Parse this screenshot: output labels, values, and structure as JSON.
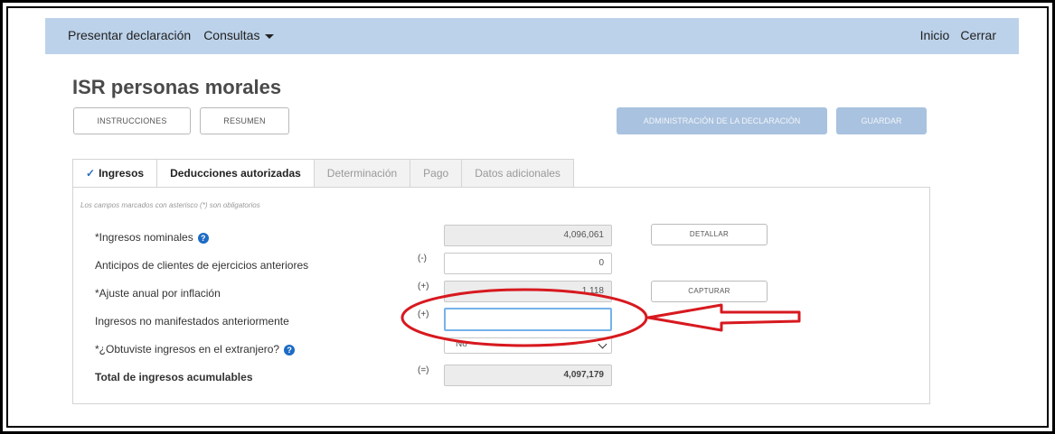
{
  "nav": {
    "presentar": "Presentar declaración",
    "consultas": "Consultas",
    "inicio": "Inicio",
    "cerrar": "Cerrar"
  },
  "page_title": "ISR personas morales",
  "toolbar": {
    "instrucciones": "INSTRUCCIONES",
    "resumen": "RESUMEN",
    "administracion": "ADMINISTRACIÓN DE LA DECLARACIÓN",
    "guardar": "GUARDAR"
  },
  "tabs": [
    {
      "label": "Ingresos",
      "state": "completed"
    },
    {
      "label": "Deducciones autorizadas",
      "state": "active"
    },
    {
      "label": "Determinación",
      "state": "disabled"
    },
    {
      "label": "Pago",
      "state": "disabled"
    },
    {
      "label": "Datos adicionales",
      "state": "disabled"
    }
  ],
  "form": {
    "required_note": "Los campos marcados con asterisco (*) son obligatorios",
    "rows": [
      {
        "label": "*Ingresos nominales",
        "sign": "",
        "value": "4,096,061",
        "button": "DETALLAR"
      },
      {
        "label": "Anticipos de clientes de ejercicios anteriores",
        "sign": "(-)",
        "value": "0"
      },
      {
        "label": "*Ajuste anual por inflación",
        "sign": "(+)",
        "value": "1,118",
        "button": "CAPTURAR"
      },
      {
        "label": "Ingresos no manifestados anteriormente",
        "sign": "(+)",
        "value": ""
      },
      {
        "label": "*¿Obtuviste ingresos en el extranjero?",
        "sign": "",
        "value": "No"
      },
      {
        "label": "Total de ingresos acumulables",
        "sign": "(=)",
        "value": "4,097,179"
      }
    ]
  },
  "colors": {
    "navbar": "#bcd2ea",
    "primary_button_disabled": "#a9c2df",
    "help_icon": "#1d6bc5",
    "annotation": "#d7191f"
  },
  "icons": {
    "help": "question-circle-icon",
    "check": "check-icon",
    "caret": "caret-down-icon"
  }
}
